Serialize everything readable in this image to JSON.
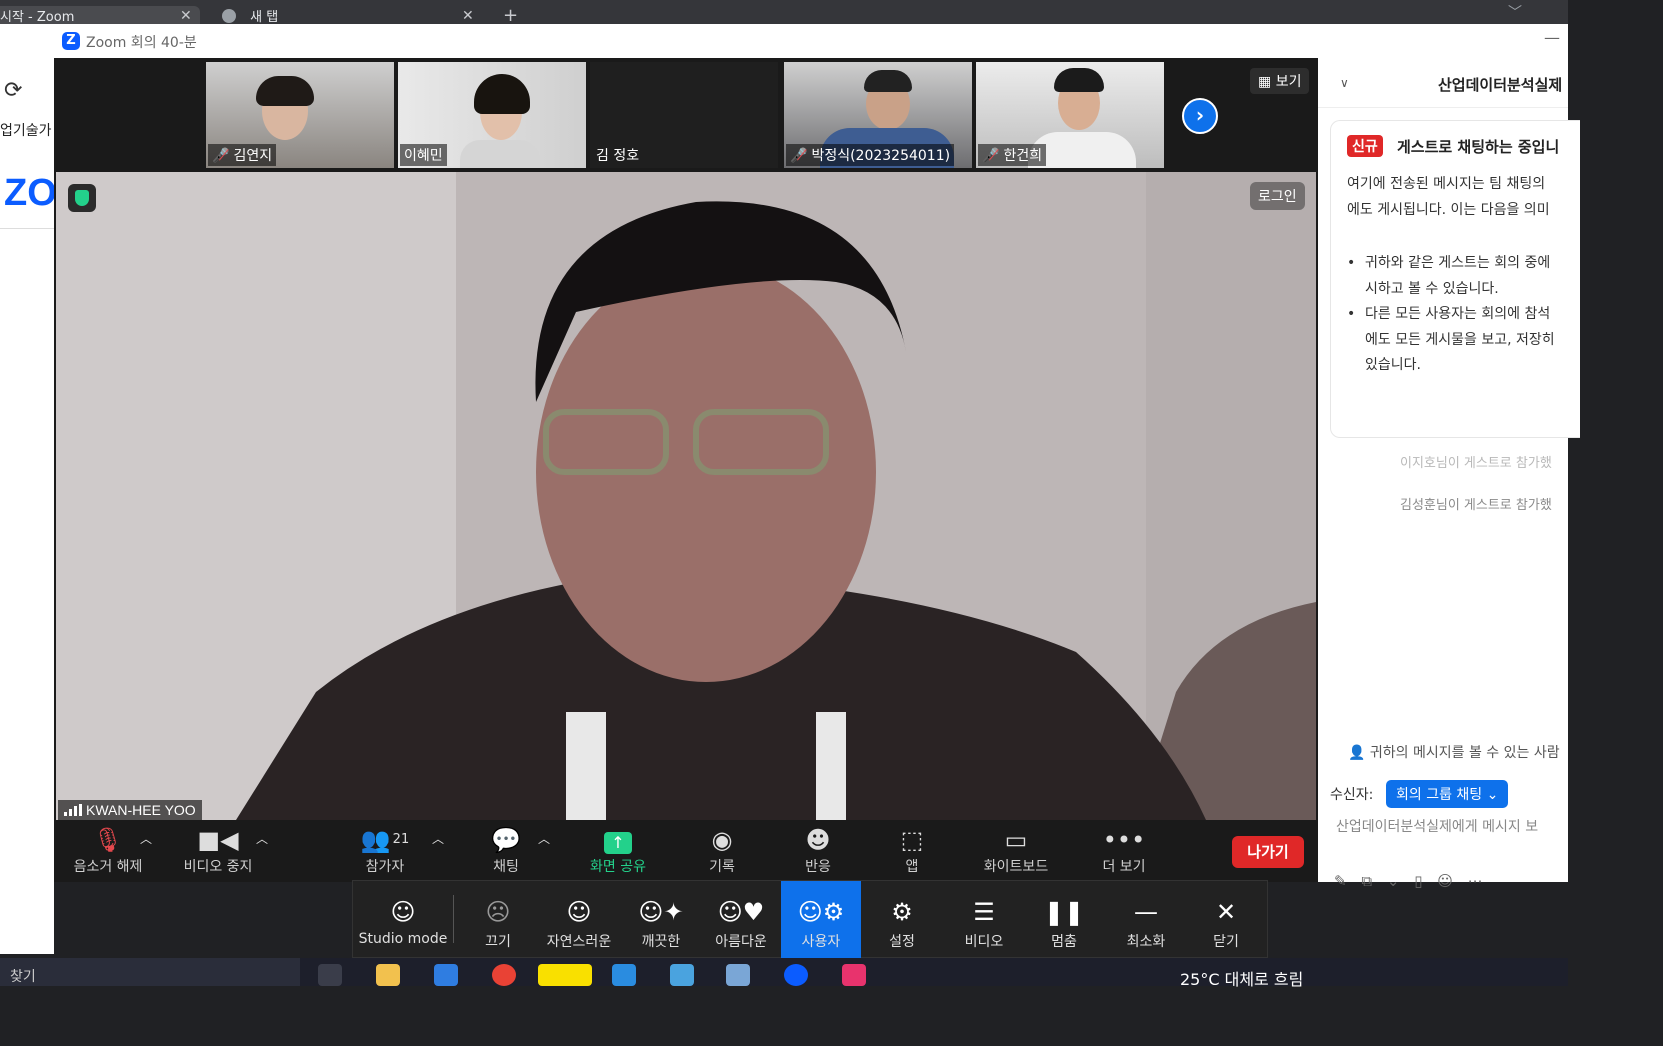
{
  "browser": {
    "tab1_title": "시작 - Zoom",
    "tab2_title": "새 탭",
    "bookmark_text": "업기술가",
    "page_logo_text": "ZO"
  },
  "zoom": {
    "window_title": "Zoom 회의 40-분",
    "view_button": "보기",
    "participants": [
      {
        "name": "김연지",
        "muted": true
      },
      {
        "name": "이혜민",
        "muted": false
      },
      {
        "name": "김 정호",
        "muted": false
      },
      {
        "name": "박정식(2023254011)",
        "muted": true
      },
      {
        "name": "한건희",
        "muted": true
      }
    ],
    "speaker_name": "KWAN-HEE YOO",
    "login_button": "로그인",
    "toolbar": {
      "unmute": "음소거 해제",
      "stop_video": "비디오 중지",
      "participants": "참가자",
      "participant_count": "21",
      "chat": "채팅",
      "share_screen": "화면 공유",
      "record": "기록",
      "reactions": "반응",
      "apps": "앱",
      "whiteboard": "화이트보드",
      "more": "더 보기",
      "leave": "나가기"
    }
  },
  "chat": {
    "title": "산업데이터분석실제",
    "notice_badge": "신규",
    "notice_title": "게스트로 채팅하는 중입니",
    "notice_body_line1": "여기에 전송된 메시지는 팀 채팅의",
    "notice_body_line2": "에도 게시됩니다. 이는 다음을 의미",
    "bullet1_line1": "귀하와 같은 게스트는 회의 중에",
    "bullet1_line2": "시하고 볼 수 있습니다.",
    "bullet2_line1": "다른 모든 사용자는 회의에 참석",
    "bullet2_line2": "에도 모든 게시물을 보고, 저장히",
    "bullet2_line3": "있습니다.",
    "system_msg_partial": "이지호님이 게스트로 참가했",
    "system_msg": "김성훈님이 게스트로 참가했",
    "visibility_note": "귀하의 메시지를 볼 수 있는 사람",
    "recipient_label": "수신자:",
    "recipient_value": "회의 그룹 채팅",
    "input_placeholder": "산업데이터분석실제에게 메시지 보"
  },
  "filters": {
    "items": [
      {
        "label": "Studio mode",
        "icon": "smile-icon"
      },
      {
        "label": "끄기",
        "icon": "face-off-icon"
      },
      {
        "label": "자연스러운",
        "icon": "smile-icon"
      },
      {
        "label": "깨끗한",
        "icon": "sparkle-face-icon"
      },
      {
        "label": "아름다운",
        "icon": "heart-face-icon"
      },
      {
        "label": "사용자",
        "icon": "custom-face-icon",
        "active": true
      },
      {
        "label": "설정",
        "icon": "gear-icon"
      },
      {
        "label": "비디오",
        "icon": "list-icon"
      },
      {
        "label": "멈춤",
        "icon": "pause-icon"
      },
      {
        "label": "최소화",
        "icon": "minimize-icon"
      },
      {
        "label": "닫기",
        "icon": "close-icon"
      }
    ]
  },
  "taskbar": {
    "search_text": "찾기",
    "weather": "25°C  대체로 흐림"
  },
  "colors": {
    "zoom_blue": "#0e71eb",
    "leave_red": "#e02828",
    "share_green": "#23d18b",
    "muted_red": "#e5484d"
  }
}
